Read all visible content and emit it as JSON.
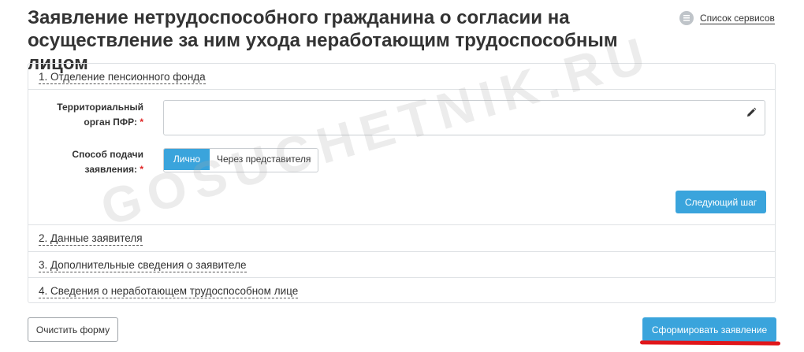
{
  "header": {
    "title": "Заявление нетрудоспособного гражданина о согласии на осуществление за ним ухода неработающим трудоспособным лицом",
    "services_link": "Список сервисов",
    "services_icon": "list-icon"
  },
  "sections": [
    {
      "label": "1. Отделение пенсионного фонда",
      "expanded": true
    },
    {
      "label": "2. Данные заявителя",
      "expanded": false
    },
    {
      "label": "3. Дополнительные сведения о заявителе",
      "expanded": false
    },
    {
      "label": "4. Сведения о неработающем трудоспособном лице",
      "expanded": false
    }
  ],
  "form": {
    "pfr_label_line1": "Территориальный",
    "pfr_label_line2": "орган ПФР:",
    "pfr_value": "",
    "method_label_line1": "Способ подачи",
    "method_label_line2": "заявления:",
    "required_mark": "*",
    "method_options": [
      "Лично",
      "Через представителя"
    ],
    "method_selected": "Лично",
    "next_button": "Следующий шаг"
  },
  "footer": {
    "clear_button": "Очистить форму",
    "submit_button": "Сформировать заявление"
  },
  "watermark": "GOSUCHETNIK.RU",
  "colors": {
    "accent": "#3aa4dc",
    "required": "#e02424",
    "highlight": "#e0161a"
  }
}
